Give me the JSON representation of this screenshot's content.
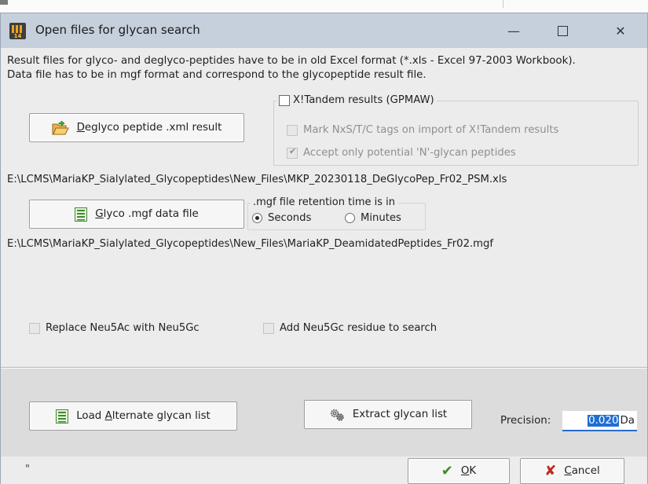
{
  "window": {
    "title": "Open files for glycan search",
    "app_icon_text": "14",
    "controls": {
      "minimize": "—",
      "close": "✕"
    }
  },
  "description": {
    "line1": "Result files for glyco- and deglyco-peptides have to be in old Excel  format (*.xls - Excel 97-2003 Workbook).",
    "line2": "Data file has to be in mgf format and correspond to the glycopeptide result file."
  },
  "deglyco_button": {
    "accel": "D",
    "rest": "eglyco peptide .xml result",
    "icon": "folder-open-icon"
  },
  "xtandem": {
    "label": "X!Tandem results (GPMAW)",
    "checked": false,
    "options": [
      {
        "label": "Mark NxS/T/C tags on import of X!Tandem results",
        "checked": false
      },
      {
        "label": "Accept only potential 'N'-glycan peptides",
        "checked": true
      }
    ]
  },
  "deglyco_path": "E:\\LCMS\\MariaKP_Sialylated_Glycopeptides\\New_Files\\MKP_20230118_DeGlycoPep_Fr02_PSM.xls",
  "glyco_button": {
    "accel": "G",
    "rest": "lyco .mgf data file",
    "icon": "data-file-icon"
  },
  "retention": {
    "label": ".mgf file retention time is in",
    "options": [
      {
        "label": "Seconds",
        "selected": true
      },
      {
        "label": "Minutes",
        "selected": false
      }
    ]
  },
  "glyco_path": "E:\\LCMS\\MariaKP_Sialylated_Glycopeptides\\New_Files\\MariaKP_DeamidatedPeptides_Fr02.mgf",
  "options": {
    "replace_neu5ac": {
      "label": "Replace Neu5Ac with Neu5Gc",
      "checked": false
    },
    "add_neu5gc": {
      "label": "Add Neu5Gc residue to search",
      "checked": false
    }
  },
  "lower": {
    "load_button": {
      "pre": "Load ",
      "accel": "A",
      "rest": "lternate glycan list",
      "icon": "list-icon"
    },
    "extract_button": {
      "label": "Extract glycan list",
      "icon": "gears-icon"
    },
    "precision_label": "Precision:",
    "precision_value": "0.020",
    "precision_unit": "Da"
  },
  "footer": {
    "status_text": "\"",
    "ok": {
      "accel": "O",
      "rest": "K",
      "icon": "checkmark-icon",
      "icon_color": "#3f8d1e"
    },
    "cancel": {
      "accel": "C",
      "rest": "ancel",
      "icon": "x-icon",
      "icon_color": "#c0281f"
    }
  }
}
